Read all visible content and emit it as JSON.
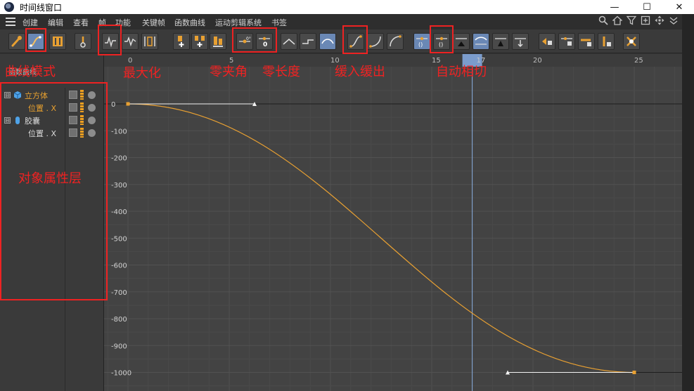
{
  "window": {
    "title": "时间线窗口",
    "minimize_glyph": "—",
    "maximize_glyph": "☐",
    "close_glyph": "✕"
  },
  "menu": {
    "items": [
      "创建",
      "编辑",
      "查看",
      "帧",
      "功能",
      "关键帧",
      "函数曲线",
      "运动剪辑系统",
      "书签"
    ]
  },
  "panel": {
    "header": "函数曲线",
    "objects": [
      {
        "label": "立方体",
        "expander": "⊟",
        "type": "cube",
        "highlight": true
      },
      {
        "label": "位置 . X",
        "type": "track",
        "highlight": true
      },
      {
        "label": "胶囊",
        "expander": "⊟",
        "type": "capsule",
        "highlight": false
      },
      {
        "label": "位置 . X",
        "type": "track",
        "highlight": false
      }
    ]
  },
  "timeline": {
    "ruler_labels": [
      "0",
      "5",
      "10",
      "15",
      "17",
      "20",
      "25"
    ],
    "current_frame": "17",
    "y_labels": [
      "0",
      "-100",
      "-200",
      "-300",
      "-400",
      "-500",
      "-600",
      "-700",
      "-800",
      "-900",
      "-1000"
    ]
  },
  "chart_data": {
    "type": "line",
    "xlim": [
      0,
      25
    ],
    "ylim": [
      -1000,
      0
    ],
    "series": [
      {
        "color": "#e8a032",
        "x": [
          0,
          3,
          6,
          9,
          12,
          15,
          18,
          21,
          24,
          25
        ],
        "y": [
          0,
          -57,
          -200,
          -396,
          -604,
          -800,
          -943,
          -990,
          -999,
          -1000
        ]
      }
    ],
    "keyframes": [
      {
        "frame": 0,
        "value": 0
      },
      {
        "frame": 25,
        "value": -1000
      }
    ],
    "grid": true,
    "current_frame": 17
  },
  "annotations": {
    "curve_mode": "曲线模式",
    "maximize": "最大化",
    "zero_angle": "零夹角",
    "zero_length": "零长度",
    "ease_in_out": "缓入缓出",
    "auto_tangent": "自动相切",
    "object_attribute_layer": "对象属性层"
  },
  "colors": {
    "accent_orange": "#e8a032",
    "annotation_red": "#ee2222",
    "active_button": "#6a88b5",
    "time_cursor": "#8aaee0"
  },
  "toolbar_icons": [
    "key-path-icon",
    "curve-mode-icon",
    "dope-sheet-icon",
    "motion-icon",
    "maximize-icon",
    "frame-all-icon",
    "frame-selected-icon",
    "add-key-icon",
    "add-key-all-icon",
    "add-key-parent-icon",
    "zero-angle-icon",
    "zero-length-icon",
    "linear-icon",
    "step-icon",
    "spline-icon",
    "ease-in-out-icon",
    "ease-in-icon",
    "ease-out-icon",
    "auto-tangent-icon",
    "auto-tangent-clamp-icon",
    "auto-tangent-removed-icon",
    "weighted-tangent-icon",
    "break-tangent-icon",
    "lock-tangent-icon",
    "lock-key-icon",
    "lock-time-icon",
    "lock-value-icon",
    "lock-tangent-length-icon",
    "interactive-icon"
  ]
}
